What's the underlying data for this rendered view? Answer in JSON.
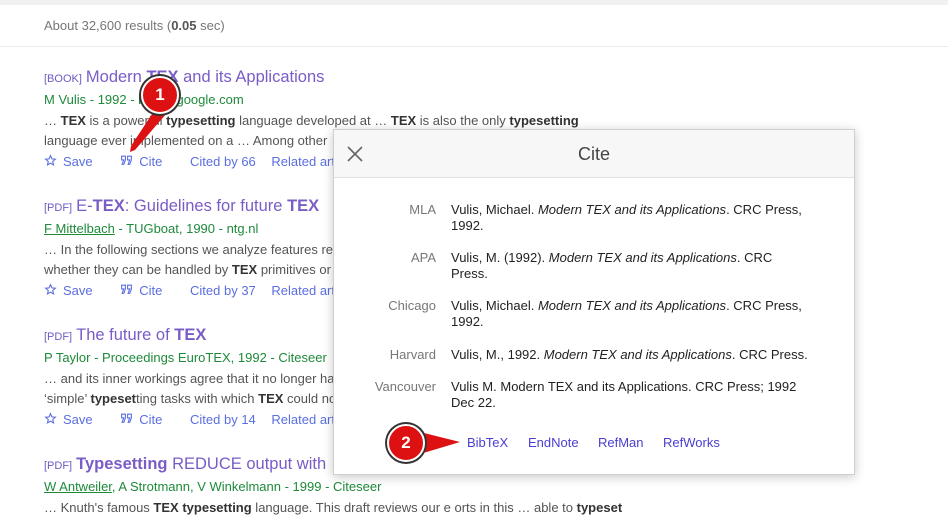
{
  "header": {
    "results_prefix": "About 32,600 results (",
    "results_time": "0.05",
    "results_suffix": " sec)"
  },
  "results": [
    {
      "tag": "[BOOK]",
      "title_parts": [
        "Modern ",
        "TEX",
        " and its Applications"
      ],
      "meta": "M Vulis - 1992 - books.google.com",
      "snippet_line1": [
        "… ",
        "TEX",
        " is a powerful ",
        "typesetting",
        " language developed at … ",
        "TEX",
        " is also the only ",
        "typesetting"
      ],
      "snippet_line2": "language ever implemented on a … Among other",
      "actions": [
        "Save",
        "Cite",
        "Cited by 66",
        "Related articles"
      ]
    },
    {
      "tag": "[PDF]",
      "title_parts": [
        "E-",
        "TEX",
        ": Guidelines for future ",
        "TEX"
      ],
      "meta_author": "F Mittelbach",
      "meta_rest": " - TUGboat, 1990 - ntg.nl",
      "snippet_line1": "… In the following sections we analyze features re",
      "snippet_line2_parts": [
        "whether they can be handled by ",
        "TEX",
        " primitives or"
      ],
      "actions": [
        "Save",
        "Cite",
        "Cited by 37",
        "Related articles"
      ]
    },
    {
      "tag": "[PDF]",
      "title_parts": [
        "The future of ",
        "TEX"
      ],
      "meta": "P Taylor - Proceedings EuroTEX, 1992 - Citeseer",
      "snippet_line1": "… and its inner workings agree that it no longer ha",
      "snippet_line2_parts": [
        "‘simple’ ",
        "typeset",
        "ting tasks with which ",
        "TEX",
        " could no"
      ],
      "actions": [
        "Save",
        "Cite",
        "Cited by 14",
        "Related articles"
      ]
    },
    {
      "tag": "[PDF]",
      "title_parts": [
        "Typesetting",
        " REDUCE output with"
      ],
      "meta_author": "W Antweiler",
      "meta_rest": ", A Strotmann, V Winkelmann - 1999 - Citeseer",
      "snippet_line1_parts": [
        "… Knuth's famous ",
        "TEX",
        " ",
        "typesetting",
        " language. This draft reviews our e orts in this … able to ",
        "typeset"
      ]
    }
  ],
  "cite_modal": {
    "title": "Cite",
    "rows": [
      {
        "label": "MLA",
        "pre": "Vulis, Michael. ",
        "italic": "Modern TEX and its Applications",
        "post": ". CRC Press, 1992."
      },
      {
        "label": "APA",
        "pre": "Vulis, M. (1992). ",
        "italic": "Modern TEX and its Applications",
        "post": ". CRC Press."
      },
      {
        "label": "Chicago",
        "pre": "Vulis, Michael. ",
        "italic": "Modern TEX and its Applications",
        "post": ". CRC Press, 1992."
      },
      {
        "label": "Harvard",
        "pre": "Vulis, M., 1992. ",
        "italic": "Modern TEX and its Applications",
        "post": ". CRC Press."
      },
      {
        "label": "Vancouver",
        "pre": "Vulis M. Modern TEX and its Applications. CRC Press; 1992 Dec 22.",
        "italic": "",
        "post": ""
      }
    ],
    "exports": [
      "BibTeX",
      "EndNote",
      "RefMan",
      "RefWorks"
    ]
  },
  "annotations": {
    "badge1": "1",
    "badge2": "2",
    "badge_color": "#dd1111"
  },
  "colors": {
    "title_link": "#7a5cc7",
    "meta_green": "#1e8a3a",
    "action_blue": "#5b6ee0"
  }
}
